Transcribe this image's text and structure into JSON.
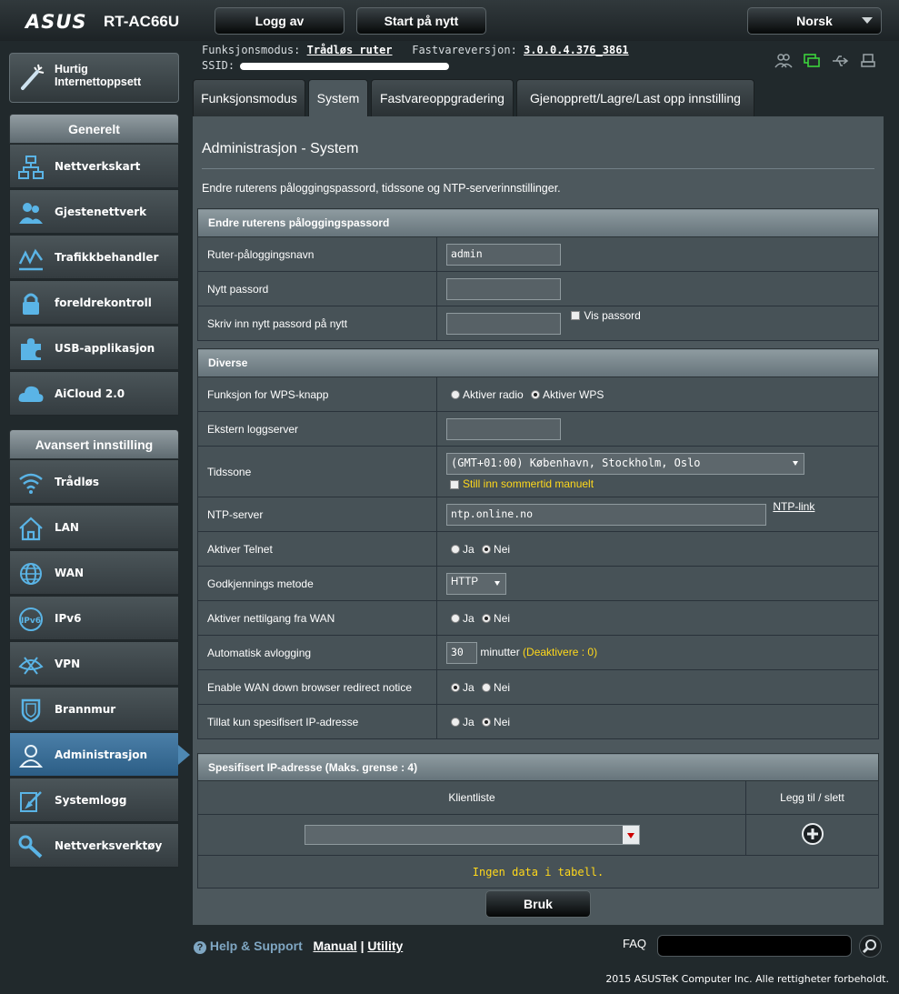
{
  "header": {
    "logo": "ASUS",
    "model": "RT-AC66U",
    "logout_label": "Logg av",
    "restart_label": "Start på nytt",
    "language": "Norsk"
  },
  "info": {
    "mode_label": "Funksjonsmodus:",
    "mode_value": "Trådløs ruter",
    "fw_label": "Fastvareversjon:",
    "fw_value": "3.0.0.4.376_3861",
    "ssid_label": "SSID:"
  },
  "tabs": [
    {
      "label": "Funksjonsmodus"
    },
    {
      "label": "System"
    },
    {
      "label": "Fastvareoppgradering"
    },
    {
      "label": "Gjenopprett/Lagre/Last opp innstilling"
    }
  ],
  "sidebar": {
    "quick_label_1": "Hurtig",
    "quick_label_2": "Internettoppsett",
    "general_header": "Generelt",
    "general_items": [
      {
        "label": "Nettverkskart"
      },
      {
        "label": "Gjestenettverk"
      },
      {
        "label": "Trafikkbehandler"
      },
      {
        "label": "foreldrekontroll"
      },
      {
        "label": "USB-applikasjon"
      },
      {
        "label": "AiCloud 2.0"
      }
    ],
    "advanced_header": "Avansert innstilling",
    "advanced_items": [
      {
        "label": "Trådløs"
      },
      {
        "label": "LAN"
      },
      {
        "label": "WAN"
      },
      {
        "label": "IPv6"
      },
      {
        "label": "VPN"
      },
      {
        "label": "Brannmur"
      },
      {
        "label": "Administrasjon"
      },
      {
        "label": "Systemlogg"
      },
      {
        "label": "Nettverksverktøy"
      }
    ]
  },
  "main": {
    "title": "Administrasjon - System",
    "description": "Endre ruterens påloggingspassord, tidssone og NTP-serverinnstillinger.",
    "password_section": {
      "header": "Endre ruterens påloggingspassord",
      "router_login_label": "Ruter-påloggingsnavn",
      "router_login_value": "admin",
      "new_password_label": "Nytt passord",
      "retype_label": "Skriv inn nytt passord på nytt",
      "show_password_label": "Vis passord"
    },
    "misc_section": {
      "header": "Diverse",
      "wps_label": "Funksjon for WPS-knapp",
      "wps_opt1": "Aktiver radio",
      "wps_opt2": "Aktiver WPS",
      "log_server_label": "Ekstern loggserver",
      "timezone_label": "Tidssone",
      "timezone_value": "(GMT+01:00) København, Stockholm, Oslo",
      "dst_label": "Still inn sommertid manuelt",
      "ntp_label": "NTP-server",
      "ntp_value": "ntp.online.no",
      "ntp_link": "NTP-link",
      "telnet_label": "Aktiver Telnet",
      "auth_label": "Godkjennings metode",
      "auth_value": "HTTP",
      "wan_access_label": "Aktiver nettilgang fra WAN",
      "auto_logout_label": "Automatisk avlogging",
      "auto_logout_value": "30",
      "auto_logout_unit": "minutter",
      "auto_logout_hint": "(Deaktivere : 0)",
      "redirect_label": "Enable WAN down browser redirect notice",
      "specified_ip_label": "Tillat kun spesifisert IP-adresse",
      "yes": "Ja",
      "no": "Nei"
    },
    "ip_section": {
      "header": "Spesifisert IP-adresse (Maks. grense : 4)",
      "col_client": "Klientliste",
      "col_add": "Legg til / slett",
      "empty": "Ingen data i tabell."
    },
    "apply_label": "Bruk"
  },
  "footer": {
    "help_label": "Help & Support",
    "manual": "Manual",
    "separator": "|",
    "utility": "Utility",
    "faq": "FAQ",
    "copyright": "2015 ASUSTeK Computer Inc. Alle rettigheter forbeholdt."
  },
  "colors": {
    "accent": "#4b7fa8",
    "hint": "#ffd81b",
    "green_status": "#3cd23c"
  }
}
